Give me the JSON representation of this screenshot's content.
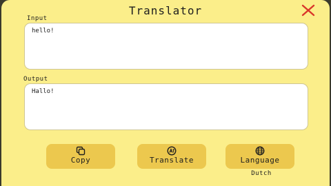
{
  "app": {
    "title": "Translator"
  },
  "input": {
    "label": "Input",
    "value": "hello!"
  },
  "output": {
    "label": "Output",
    "value": "Hallo!"
  },
  "buttons": {
    "copy": {
      "label": "Copy",
      "icon": "copy-icon"
    },
    "translate": {
      "label": "Translate",
      "icon": "translate-icon"
    },
    "language": {
      "label": "Language",
      "icon": "globe-icon",
      "selected": "Dutch"
    }
  },
  "colors": {
    "window_bg": "#fbee8a",
    "button_bg": "#ecc84e",
    "close_icon": "#d9362b",
    "text_box_bg": "#ffffff"
  }
}
